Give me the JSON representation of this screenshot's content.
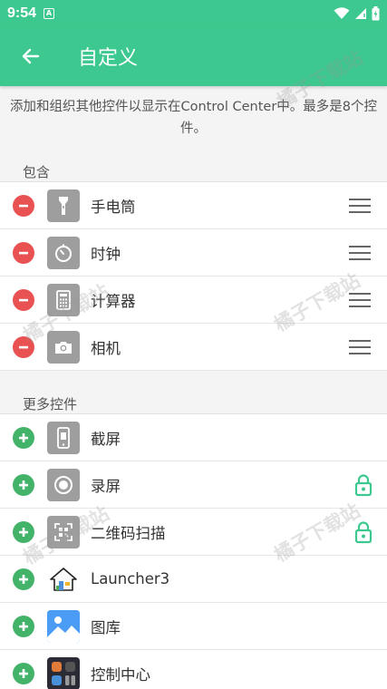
{
  "status_bar": {
    "time": "9:54",
    "notification_glyph": "A"
  },
  "app_bar": {
    "title": "自定义",
    "back_icon": "arrow-left-icon"
  },
  "description": "添加和组织其他控件以显示在Control Center中。最多是8个控件。",
  "included": {
    "header": "包含",
    "items": [
      {
        "label": "手电筒",
        "icon": "flashlight-icon"
      },
      {
        "label": "时钟",
        "icon": "timer-icon"
      },
      {
        "label": "计算器",
        "icon": "calculator-icon"
      },
      {
        "label": "相机",
        "icon": "camera-icon"
      }
    ]
  },
  "more": {
    "header": "更多控件",
    "items": [
      {
        "label": "截屏",
        "icon": "screenshot-icon",
        "locked": false
      },
      {
        "label": "录屏",
        "icon": "screen-record-icon",
        "locked": true
      },
      {
        "label": "二维码扫描",
        "icon": "qr-scan-icon",
        "locked": true
      },
      {
        "label": "Launcher3",
        "icon": "launcher-house-icon",
        "locked": false
      },
      {
        "label": "图库",
        "icon": "gallery-icon",
        "locked": false
      },
      {
        "label": "控制中心",
        "icon": "control-center-icon",
        "locked": false
      }
    ]
  },
  "watermark_text": "橘子下载站",
  "colors": {
    "primary": "#3cc88e",
    "remove": "#e95252",
    "add": "#44b36a",
    "lock": "#3cc88e"
  }
}
